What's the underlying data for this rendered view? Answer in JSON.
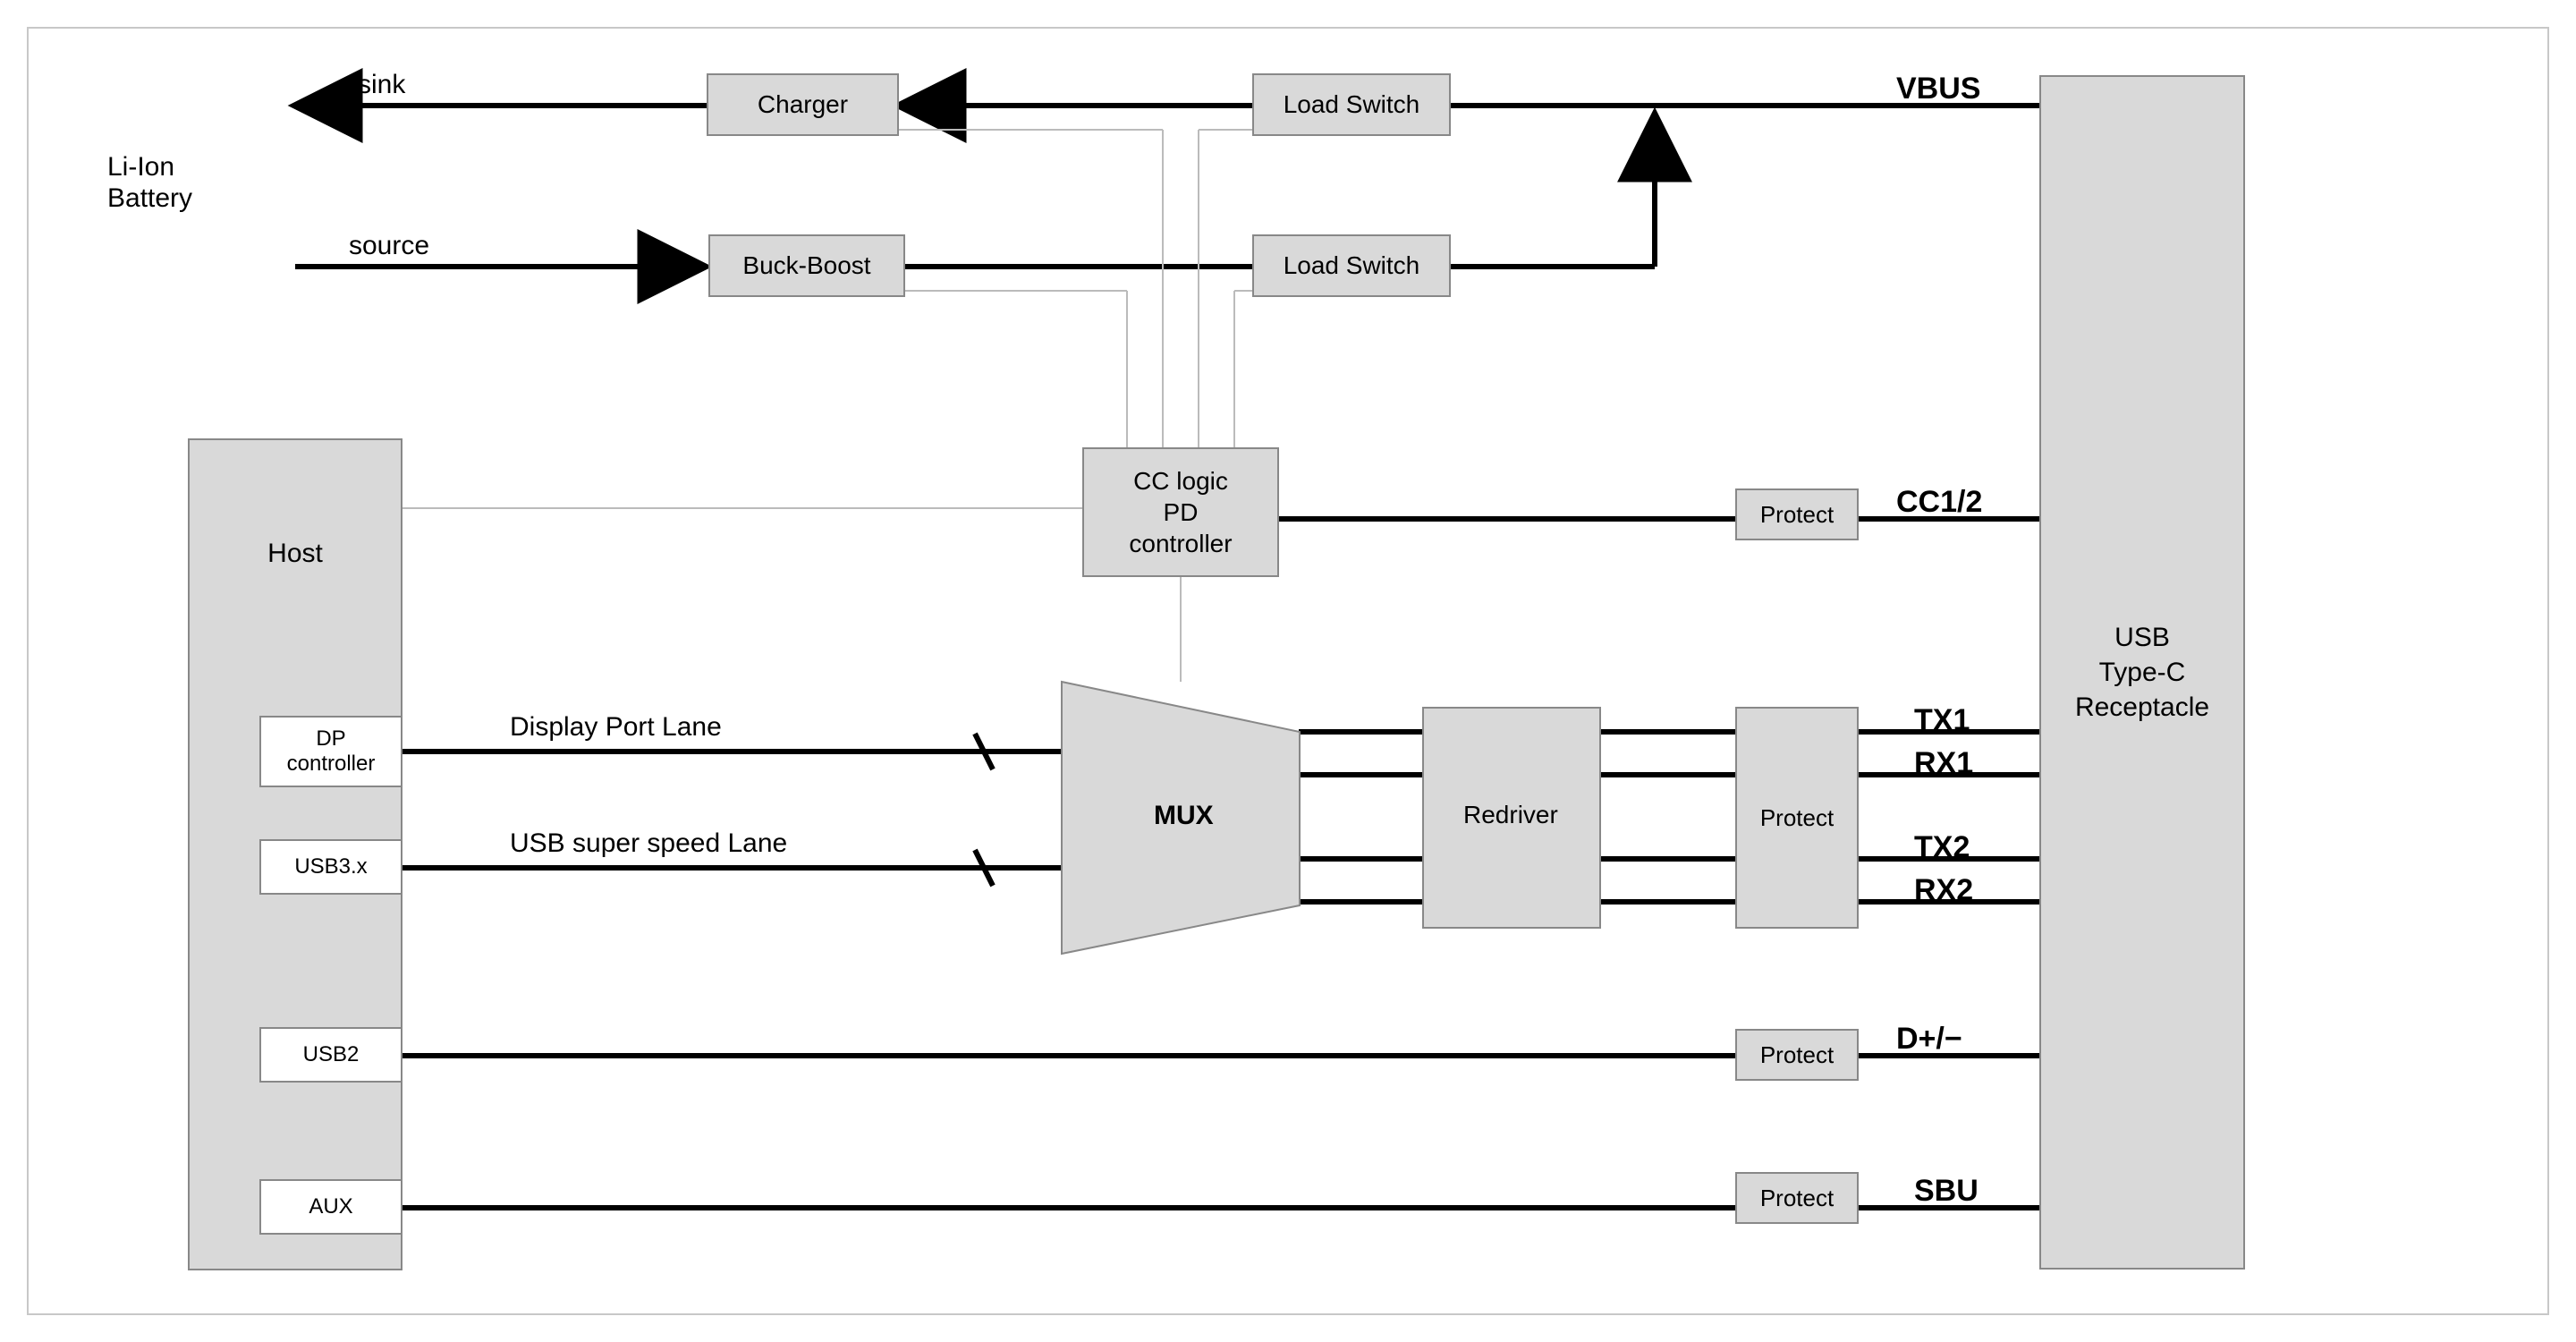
{
  "labels": {
    "battery": "Li-Ion\nBattery",
    "sink": "sink",
    "source": "source",
    "host": "Host",
    "dp": "DP\ncontroller",
    "usb3": "USB3.x",
    "usb2": "USB2",
    "aux": "AUX",
    "dpLane": "Display Port Lane",
    "ssLane": "USB super speed Lane",
    "charger": "Charger",
    "buck": "Buck-Boost",
    "ls1": "Load Switch",
    "ls2": "Load Switch",
    "cc": "CC logic\nPD\ncontroller",
    "mux": "MUX",
    "redriver": "Redriver",
    "protect": "Protect",
    "vbus": "VBUS",
    "cc12": "CC1/2",
    "tx1": "TX1",
    "rx1": "RX1",
    "tx2": "TX2",
    "rx2": "RX2",
    "dpm": "D+/−",
    "sbu": "SBU",
    "recept": "USB\nType-C\nReceptacle"
  }
}
